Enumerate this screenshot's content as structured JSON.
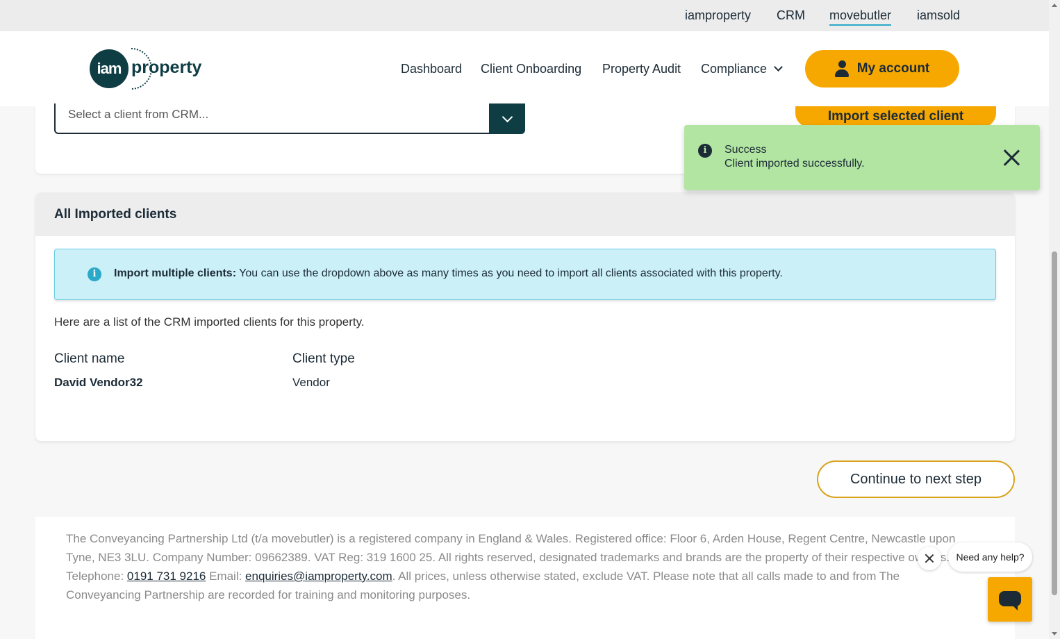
{
  "brandbar": {
    "links": [
      "iamproperty",
      "CRM",
      "movebutler",
      "iamsold"
    ],
    "active": "movebutler"
  },
  "header": {
    "logo_badge": "iam",
    "logo_word": "property",
    "nav": [
      "Dashboard",
      "Client Onboarding",
      "Property Audit",
      "Compliance"
    ],
    "account_label": "My account"
  },
  "import_card": {
    "select_placeholder": "Select a client from CRM...",
    "import_button": "Import selected client"
  },
  "toast": {
    "title": "Success",
    "message": "Client imported successfully."
  },
  "imported": {
    "heading": "All Imported clients",
    "info_bold": "Import multiple clients:",
    "info_text": " You can use the dropdown above as many times as you need to import all clients associated with this property.",
    "intro": "Here are a list of the CRM imported clients for this property.",
    "columns": [
      "Client name",
      "Client type"
    ],
    "rows": [
      {
        "name": "David Vendor32",
        "type": "Vendor"
      }
    ]
  },
  "continue_label": "Continue to next step",
  "footer": {
    "text1": "The Conveyancing Partnership Ltd (t/a movebutler) is a registered company in England & Wales. Registered office: Floor 6, Arden House, Regent Centre, Newcastle upon Tyne, NE3 3LU. Company Number: 09662389. VAT Reg: 319 1600 25. All rights reserved, designated trademarks and brands are the property of their respective owners. Telephone: ",
    "phone": "0191 731 9216",
    "text2": " Email: ",
    "email": "enquiries@iamproperty.com",
    "text3": ". All prices, unless otherwise stated, exclude VAT. Please note that all calls made to and from The Conveyancing Partnership are recorded for training and monitoring purposes."
  },
  "help": {
    "bubble": "Need any help?"
  },
  "colors": {
    "accent": "#f7a800",
    "brand_dark": "#0f3d44",
    "success_bg": "#b2e5a2",
    "info_bg": "#cbf0f8"
  }
}
